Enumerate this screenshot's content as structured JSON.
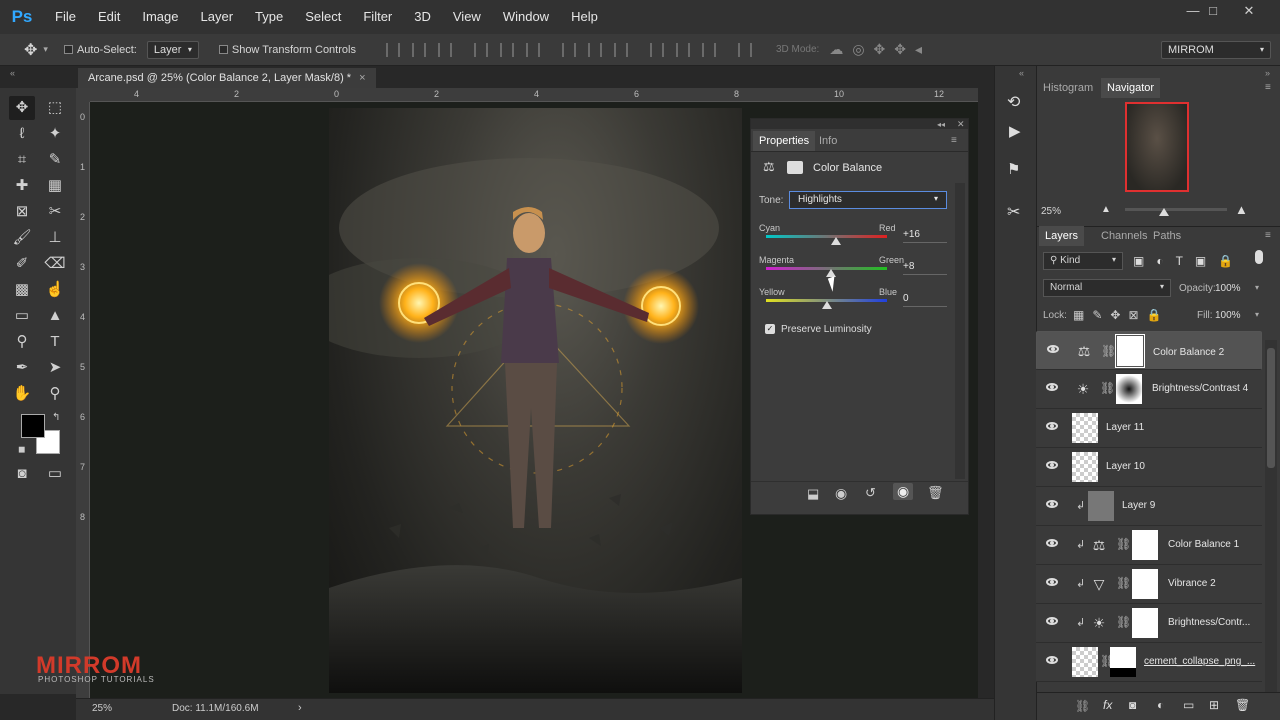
{
  "app": {
    "logo": "Ps"
  },
  "menu": [
    "File",
    "Edit",
    "Image",
    "Layer",
    "Type",
    "Select",
    "Filter",
    "3D",
    "View",
    "Window",
    "Help"
  ],
  "window_controls": {
    "minimize": "—",
    "maximize": "□",
    "close": "✕"
  },
  "options": {
    "auto_select_label": "Auto-Select:",
    "auto_select_value": "Layer",
    "show_transform_label": "Show Transform Controls",
    "mode_3d_label": "3D Mode:",
    "workspace": "MIRROM"
  },
  "document": {
    "tab_title": "Arcane.psd @ 25% (Color Balance 2, Layer Mask/8) *",
    "tab_close": "×",
    "ruler_h": [
      "4",
      "2",
      "0",
      "2",
      "4",
      "6",
      "8",
      "10",
      "12"
    ],
    "ruler_v": [
      "0",
      "1",
      "2",
      "3",
      "4",
      "5",
      "6",
      "7",
      "8"
    ]
  },
  "status": {
    "zoom": "25%",
    "doc_size": "Doc: 11.1M/160.6M"
  },
  "watermark": {
    "brand": "MIRROM",
    "sub": "PHOTOSHOP TUTORIALS"
  },
  "properties": {
    "tabs": [
      "Properties",
      "Info"
    ],
    "title": "Color Balance",
    "tone_label": "Tone:",
    "tone_value": "Highlights",
    "sliders": [
      {
        "left": "Cyan",
        "right": "Red",
        "value": "+16",
        "level": 0.58,
        "colors": [
          "#00c8c8",
          "#e02020"
        ]
      },
      {
        "left": "Magenta",
        "right": "Green",
        "value": "+8",
        "level": 0.54,
        "colors": [
          "#d020d0",
          "#20c020"
        ]
      },
      {
        "left": "Yellow",
        "right": "Blue",
        "value": "0",
        "level": 0.5,
        "colors": [
          "#e0e020",
          "#2040e0"
        ]
      }
    ],
    "preserve_luminosity": "Preserve Luminosity"
  },
  "navigator": {
    "tabs": [
      "Histogram",
      "Navigator"
    ],
    "zoom": "25%"
  },
  "layers_panel": {
    "tabs": [
      "Layers",
      "Channels",
      "Paths"
    ],
    "filter_kind": "Kind",
    "blend_mode": "Normal",
    "opacity_label": "Opacity:",
    "opacity_value": "100%",
    "lock_label": "Lock:",
    "fill_label": "Fill:",
    "fill_value": "100%",
    "layers": [
      {
        "name": "Color Balance 2",
        "icon": "⚖",
        "type": "adjustment",
        "clipped": false,
        "selected": true
      },
      {
        "name": "Brightness/Contrast 4",
        "icon": "☀",
        "type": "adjustment",
        "clipped": false,
        "selected": false
      },
      {
        "name": "Layer 11",
        "icon": "",
        "type": "pixel",
        "clipped": false,
        "selected": false
      },
      {
        "name": "Layer 10",
        "icon": "",
        "type": "pixel",
        "clipped": false,
        "selected": false
      },
      {
        "name": "Layer 9",
        "icon": "",
        "type": "gray",
        "clipped": true,
        "selected": false
      },
      {
        "name": "Color Balance 1",
        "icon": "⚖",
        "type": "adjustment",
        "clipped": true,
        "selected": false
      },
      {
        "name": "Vibrance 2",
        "icon": "▽",
        "type": "adjustment",
        "clipped": true,
        "selected": false
      },
      {
        "name": "Brightness/Contr...",
        "icon": "☀",
        "type": "adjustment",
        "clipped": true,
        "selected": false
      },
      {
        "name": "cement_collapse_png_...",
        "icon": "",
        "type": "smart",
        "clipped": false,
        "selected": false
      }
    ]
  }
}
